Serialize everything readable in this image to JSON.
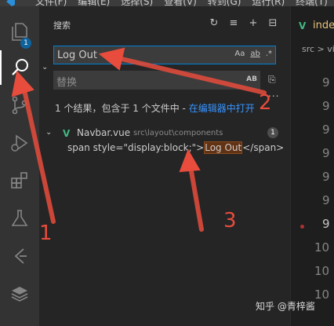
{
  "menubar": {
    "items": [
      "文件(F)",
      "编辑(E)",
      "选择(S)",
      "查看(V)",
      "转到(G)",
      "运行(R)",
      "终端(T)"
    ]
  },
  "activity_bar": {
    "items": [
      {
        "icon": "files-icon",
        "badge": "1"
      },
      {
        "icon": "search-icon"
      },
      {
        "icon": "source-control-icon"
      },
      {
        "icon": "run-debug-icon"
      },
      {
        "icon": "extensions-icon"
      },
      {
        "icon": "testing-icon"
      },
      {
        "icon": "git-graph-icon"
      },
      {
        "icon": "layers-icon"
      }
    ]
  },
  "sidebar": {
    "title": "搜索",
    "search": {
      "value": "Log Out",
      "options": {
        "case": "Aa",
        "whole_word": "ab",
        "regex": ".*"
      }
    },
    "replace": {
      "placeholder": "替换",
      "preserve_case": "AB"
    },
    "more": "...",
    "summary_text": "1 个结果，包含于 1 个文件中 - ",
    "summary_link": "在编辑器中打开",
    "results": [
      {
        "filename": "Navbar.vue",
        "path": "src\\layout\\components",
        "count": "1",
        "match": {
          "before": "span style=\"display:block;\">",
          "hit": "Log Out",
          "after": "</span>"
        }
      }
    ]
  },
  "editor": {
    "tab": "inde",
    "breadcrumb": "src > vi",
    "line_numbers": [
      "9",
      "9",
      "9",
      "9",
      "9",
      "9",
      "9",
      "10",
      "10",
      "10"
    ]
  },
  "annotations": {
    "labels": [
      "1",
      "2",
      "3"
    ],
    "color": "#e74c3c"
  },
  "watermark": "知乎 @青梓酱"
}
